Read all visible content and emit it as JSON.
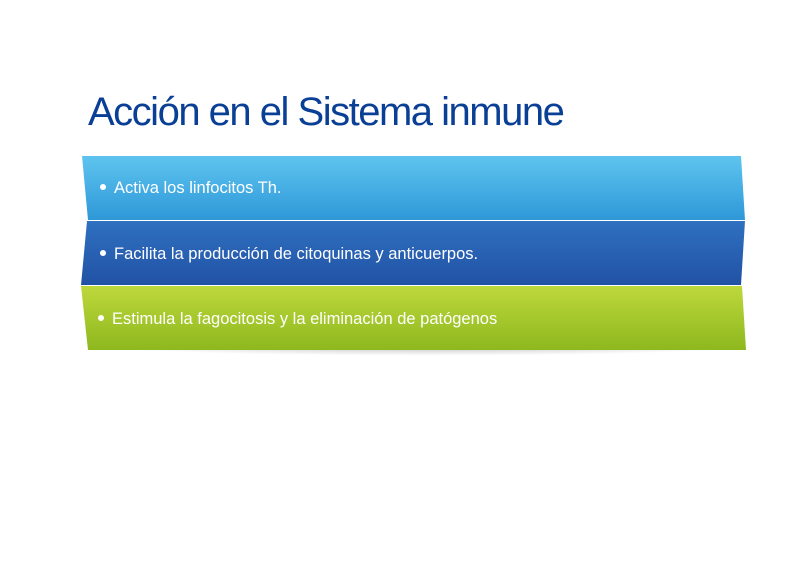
{
  "slide": {
    "title": "Acción en el Sistema inmune",
    "items": [
      {
        "label": "Activa los linfocitos Th.",
        "color_top": "#5dc3ee",
        "color_bottom": "#2f9ad9"
      },
      {
        "label": "Facilita la producción de citoquinas y anticuerpos.",
        "color_top": "#2f6fbf",
        "color_bottom": "#2353a6"
      },
      {
        "label": "Estimula la fagocitosis y la eliminación de patógenos",
        "color_top": "#bcd63a",
        "color_bottom": "#8fba1f"
      }
    ]
  }
}
